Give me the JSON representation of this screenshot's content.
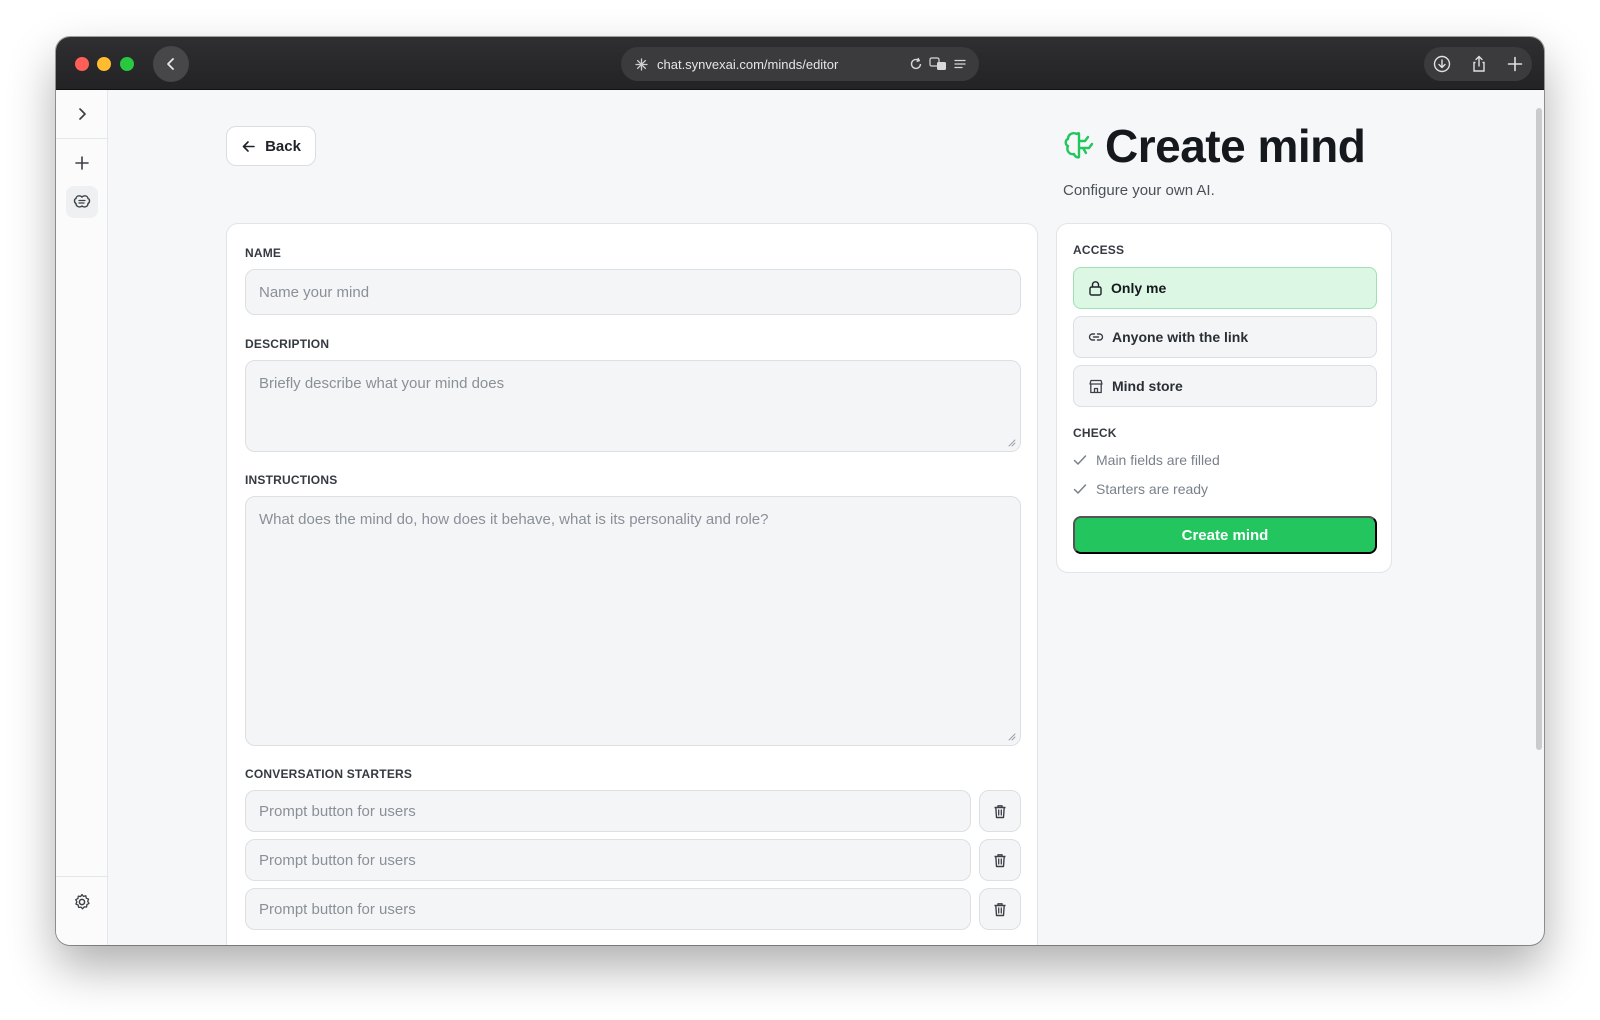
{
  "browser": {
    "url": "chat.synvexai.com/minds/editor"
  },
  "page": {
    "back_label": "Back",
    "title": "Create mind",
    "subtitle": "Configure your own AI."
  },
  "form": {
    "name": {
      "label": "NAME",
      "placeholder": "Name your mind"
    },
    "description": {
      "label": "DESCRIPTION",
      "placeholder": "Briefly describe what your mind does"
    },
    "instructions": {
      "label": "INSTRUCTIONS",
      "placeholder": "What does the mind do, how does it behave, what is its personality and role?"
    },
    "starters": {
      "label": "CONVERSATION STARTERS",
      "items": [
        {
          "placeholder": "Prompt button for users"
        },
        {
          "placeholder": "Prompt button for users"
        },
        {
          "placeholder": "Prompt button for users"
        }
      ]
    }
  },
  "access": {
    "label": "ACCESS",
    "options": [
      {
        "label": "Only me",
        "icon": "lock-icon",
        "selected": true
      },
      {
        "label": "Anyone with the link",
        "icon": "link-icon",
        "selected": false
      },
      {
        "label": "Mind store",
        "icon": "store-icon",
        "selected": false
      }
    ]
  },
  "check": {
    "label": "CHECK",
    "items": [
      {
        "label": "Main fields are filled"
      },
      {
        "label": "Starters are ready"
      }
    ]
  },
  "create_button": {
    "label": "Create mind"
  },
  "colors": {
    "accent": "#22c55e",
    "selected_bg": "#dcf7e3",
    "titlebar": "#2a2a2c"
  }
}
